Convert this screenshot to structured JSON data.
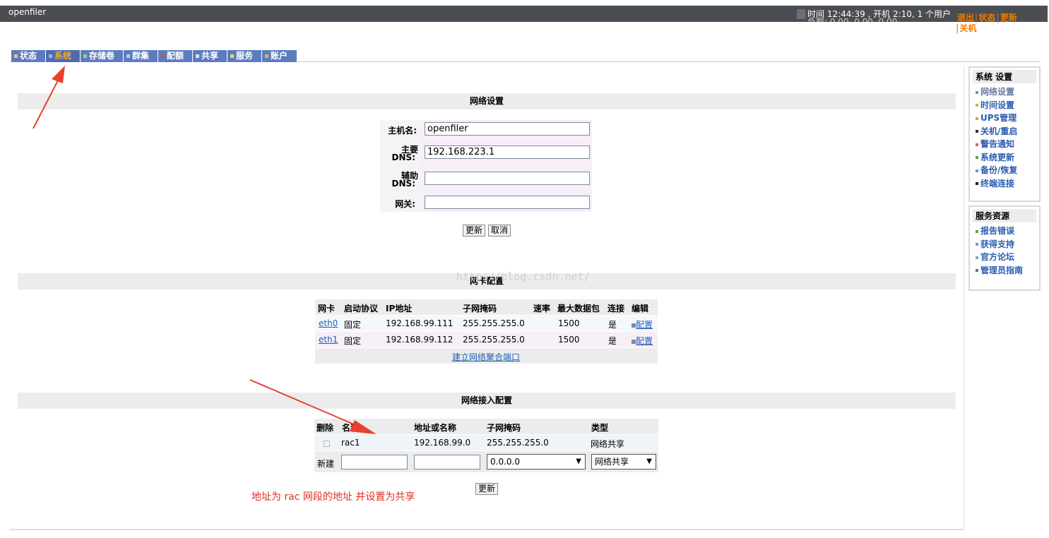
{
  "topbar": {
    "logo": "openfiler",
    "status_line": "时间 12:44:39 , 开机 2:10, 1 个用户",
    "status_line2": "负载: 0.00, 0.00, 0.00",
    "links": [
      "退出",
      "状态",
      "更新"
    ],
    "link_shutdown": "关机"
  },
  "tabs": [
    {
      "label": "状态"
    },
    {
      "label": "系统"
    },
    {
      "label": "存储卷"
    },
    {
      "label": "群集"
    },
    {
      "label": "配额"
    },
    {
      "label": "共享"
    },
    {
      "label": "服务"
    },
    {
      "label": "账户"
    }
  ],
  "network": {
    "title": "网络设置",
    "hostname_label": "主机名:",
    "hostname_value": "openfiler",
    "dns1_label_a": "主要",
    "dns1_label_b": "DNS:",
    "dns1_value": "192.168.223.1",
    "dns2_label_a": "辅助",
    "dns2_label_b": "DNS:",
    "dns2_value": "",
    "gateway_label": "网关:",
    "gateway_value": "",
    "update_button": "更新",
    "cancel_button": "取消"
  },
  "watermark": "http://blog.csdn.net/",
  "nic": {
    "title": "网卡配置",
    "headers": [
      "网卡",
      "启动协议",
      "IP地址",
      "子网掩码",
      "速率",
      "最大数据包",
      "连接",
      "编辑"
    ],
    "rows": [
      {
        "nic": "eth0",
        "protocol": "固定",
        "ip": "192.168.99.111",
        "mask": "255.255.255.0",
        "speed": "",
        "mtu": "1500",
        "link": "是",
        "edit": "配置"
      },
      {
        "nic": "eth1",
        "protocol": "固定",
        "ip": "192.168.99.112",
        "mask": "255.255.255.0",
        "speed": "",
        "mtu": "1500",
        "link": "是",
        "edit": "配置"
      }
    ],
    "bond_link": "建立网络聚合端口"
  },
  "access": {
    "title": "网络接入配置",
    "headers": [
      "删除",
      "名称",
      "地址或名称",
      "子网掩码",
      "类型"
    ],
    "rows": [
      {
        "name": "rac1",
        "address": "192.168.99.0",
        "mask": "255.255.255.0",
        "type": "网络共享"
      }
    ],
    "new_label": "新建",
    "new_mask_option": "0.0.0.0",
    "new_type_option": "网络共享",
    "update_button": "更新"
  },
  "annotation": "地址为 rac 网段的地址 并设置为共享",
  "sidebar": {
    "system_title": "系统 设置",
    "system_items": [
      {
        "label": "网络设置",
        "color": "#7a8ab0"
      },
      {
        "label": "时间设置",
        "color": "#c8b060"
      },
      {
        "label": "UPS管理",
        "color": "#d0a040"
      },
      {
        "label": "关机/重启",
        "color": "#303030"
      },
      {
        "label": "警告通知",
        "color": "#e06060"
      },
      {
        "label": "系统更新",
        "color": "#60a060"
      },
      {
        "label": "备份/恢复",
        "color": "#8090c0"
      },
      {
        "label": "终端连接",
        "color": "#202020"
      }
    ],
    "resources_title": "服务资源",
    "resource_items": [
      {
        "label": "报告错误",
        "color": "#60a060"
      },
      {
        "label": "获得支持",
        "color": "#8090c0"
      },
      {
        "label": "官方论坛",
        "color": "#90a0c0"
      },
      {
        "label": "管理员指南",
        "color": "#6070a0"
      }
    ]
  }
}
